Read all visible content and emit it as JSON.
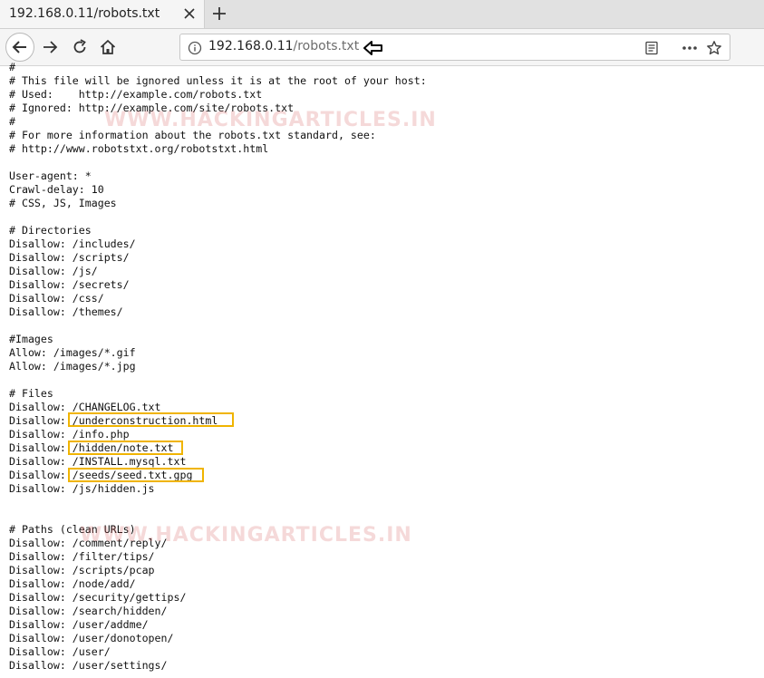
{
  "tab": {
    "title": "192.168.0.11/robots.txt"
  },
  "urlbar": {
    "host": "192.168.0.11",
    "path": "/robots.txt"
  },
  "watermark": "WWW.HACKINGARTICLES.IN",
  "robots_txt": [
    "#",
    "# This file will be ignored unless it is at the root of your host:",
    "# Used:    http://example.com/robots.txt",
    "# Ignored: http://example.com/site/robots.txt",
    "#",
    "# For more information about the robots.txt standard, see:",
    "# http://www.robotstxt.org/robotstxt.html",
    "",
    "User-agent: *",
    "Crawl-delay: 10",
    "# CSS, JS, Images",
    "",
    "# Directories",
    "Disallow: /includes/",
    "Disallow: /scripts/",
    "Disallow: /js/",
    "Disallow: /secrets/",
    "Disallow: /css/",
    "Disallow: /themes/",
    "",
    "#Images",
    "Allow: /images/*.gif",
    "Allow: /images/*.jpg",
    "",
    "# Files",
    "Disallow: /CHANGELOG.txt",
    "Disallow: /underconstruction.html",
    "Disallow: /info.php",
    "Disallow: /hidden/note.txt",
    "Disallow: /INSTALL.mysql.txt",
    "Disallow: /seeds/seed.txt.gpg",
    "Disallow: /js/hidden.js",
    "",
    "",
    "# Paths (clean URLs)",
    "Disallow: /comment/reply/",
    "Disallow: /filter/tips/",
    "Disallow: /scripts/pcap",
    "Disallow: /node/add/",
    "Disallow: /security/gettips/",
    "Disallow: /search/hidden/",
    "Disallow: /user/addme/",
    "Disallow: /user/donotopen/",
    "Disallow: /user/",
    "Disallow: /user/settings/"
  ],
  "highlight_color": "#f0b400"
}
